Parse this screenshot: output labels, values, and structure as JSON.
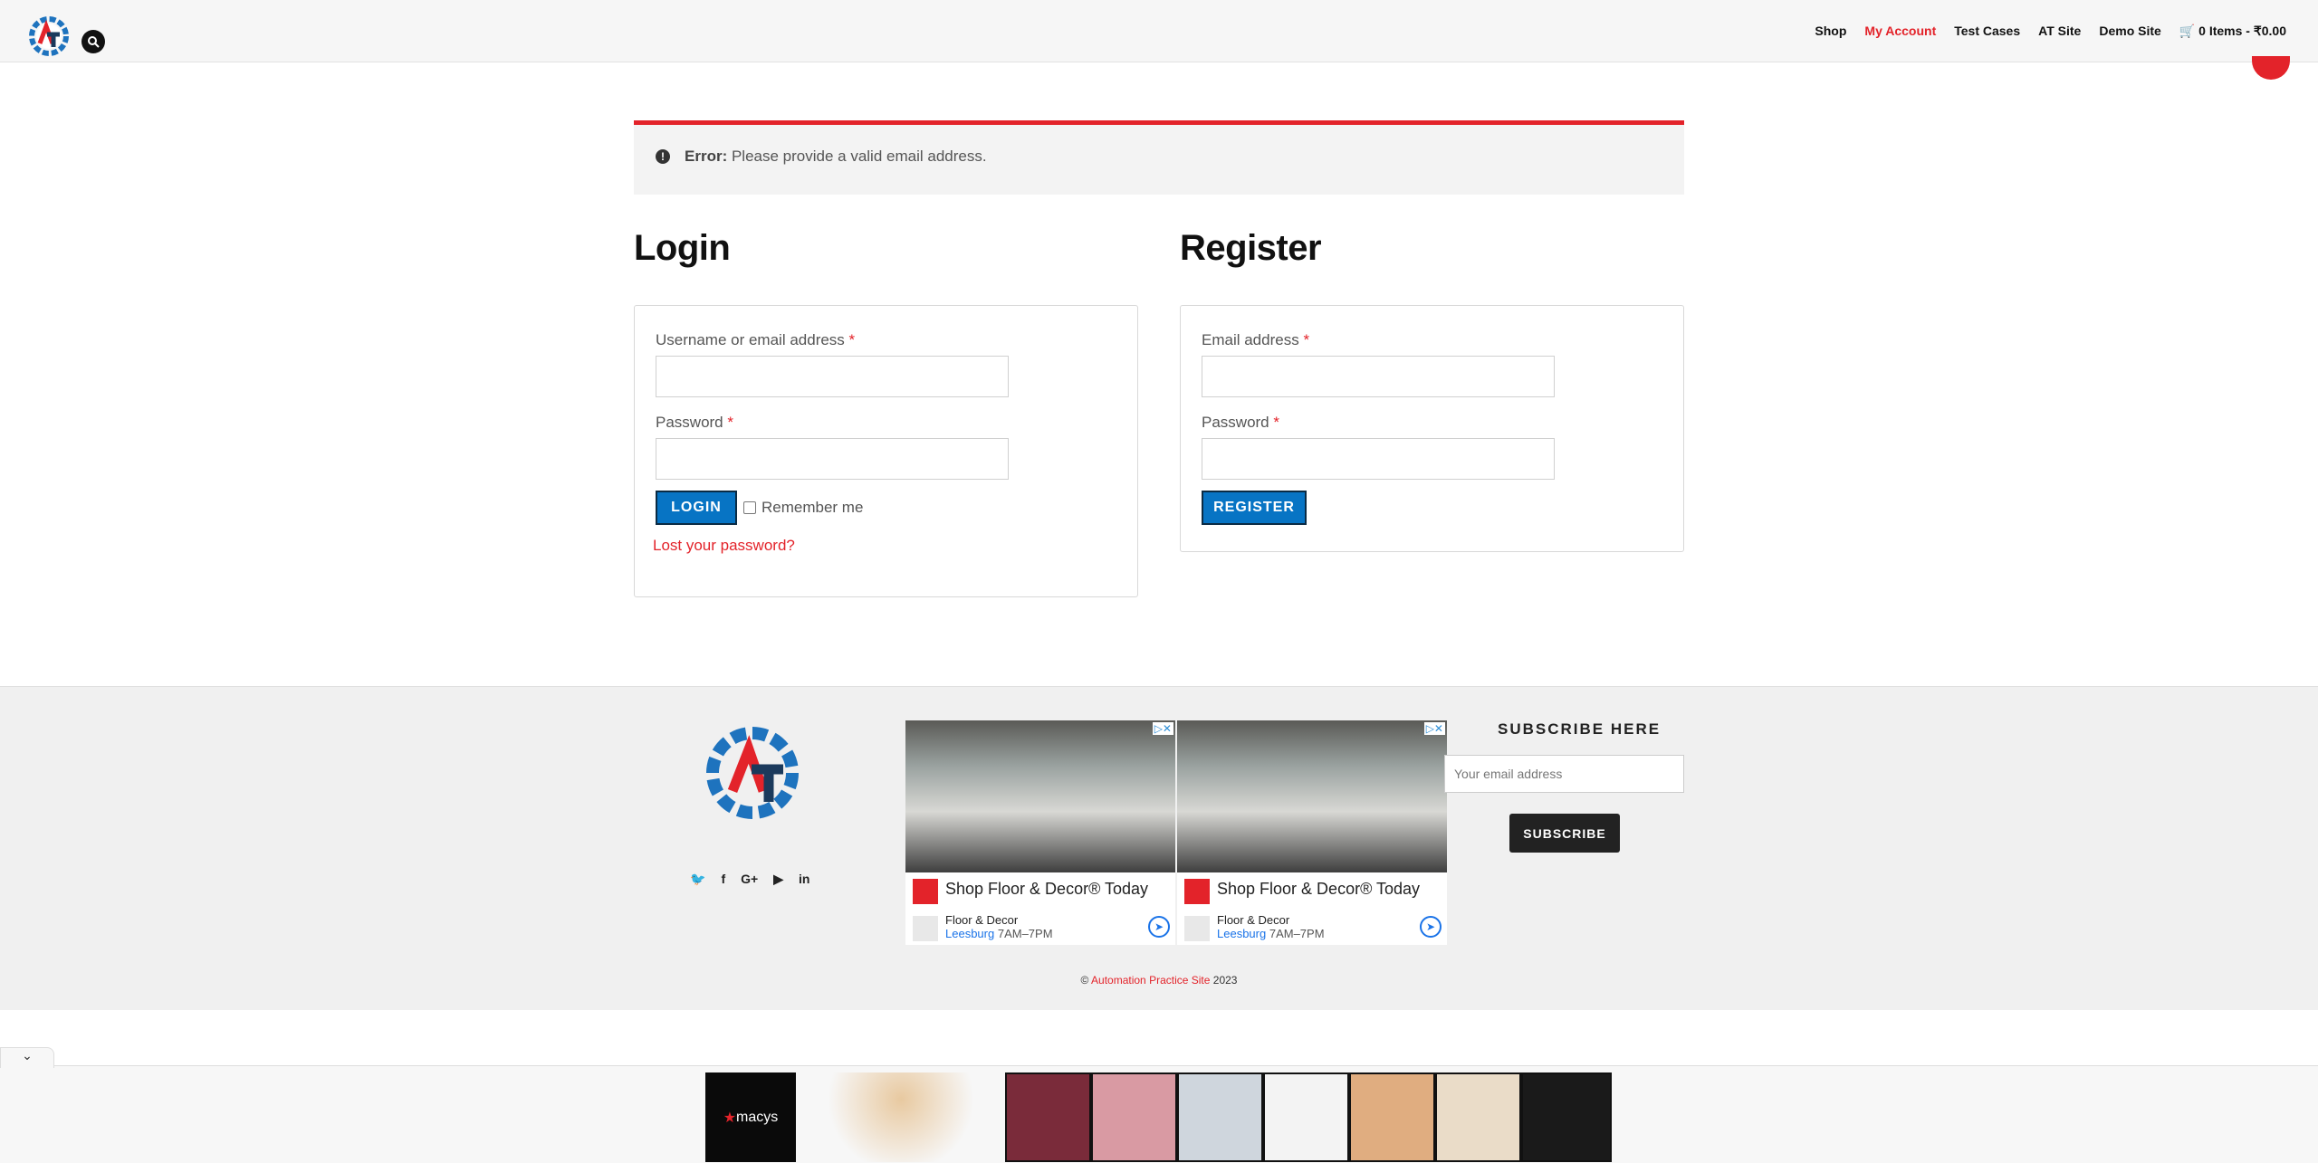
{
  "header": {
    "nav": [
      "Shop",
      "My Account",
      "Test Cases",
      "AT Site",
      "Demo Site"
    ],
    "active": "My Account",
    "cart": "0 Items - ₹0.00"
  },
  "error": {
    "label": "Error:",
    "message": "Please provide a valid email address."
  },
  "login": {
    "title": "Login",
    "username_label": "Username or email address",
    "password_label": "Password",
    "required_mark": "*",
    "button": "LOGIN",
    "remember": "Remember me",
    "lost_password": "Lost your password?"
  },
  "register": {
    "title": "Register",
    "email_label": "Email address",
    "password_label": "Password",
    "required_mark": "*",
    "button": "REGISTER"
  },
  "footer": {
    "subscribe_title": "SUBSCRIBE HERE",
    "subscribe_placeholder": "Your email address",
    "subscribe_button": "SUBSCRIBE",
    "social_icons": [
      "twitter-icon",
      "facebook-icon",
      "google-plus-icon",
      "youtube-icon",
      "linkedin-icon"
    ],
    "copyright_prefix": "©",
    "copyright_site": "Automation Practice Site",
    "copyright_year": "2023"
  },
  "ads": {
    "headline": "Shop Floor & Decor® Today",
    "store": "Floor & Decor",
    "city": "Leesburg",
    "hours": "7AM–7PM"
  },
  "bottom_ad": {
    "brand": "macys"
  },
  "colors": {
    "accent": "#e3232a",
    "button_blue": "#0774c4",
    "footer_bg": "#f0f0f0"
  }
}
